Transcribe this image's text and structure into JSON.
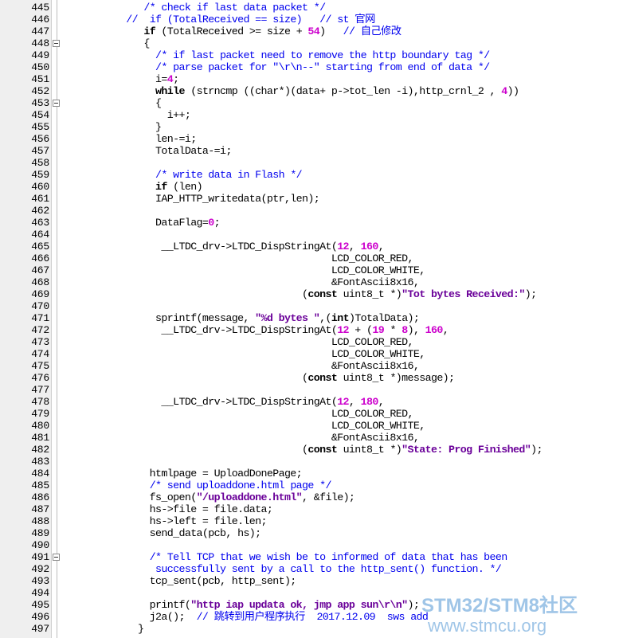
{
  "editor": {
    "lines": [
      {
        "no": "445",
        "fold": false,
        "tokens": [
          {
            "t": "            "
          },
          {
            "c": "comment",
            "t": "/* check if last data packet */"
          }
        ]
      },
      {
        "no": "446",
        "fold": false,
        "tokens": [
          {
            "t": "         "
          },
          {
            "c": "comment",
            "t": "//  if (TotalReceived == size)   // st 官网"
          }
        ]
      },
      {
        "no": "447",
        "fold": false,
        "tokens": [
          {
            "t": "            "
          },
          {
            "c": "keyword",
            "t": "if"
          },
          {
            "t": " (TotalReceived >= size + "
          },
          {
            "c": "number",
            "t": "54"
          },
          {
            "t": ")   "
          },
          {
            "c": "comment",
            "t": "// 自己修改"
          }
        ]
      },
      {
        "no": "448",
        "fold": true,
        "tokens": [
          {
            "t": "            {"
          }
        ]
      },
      {
        "no": "449",
        "fold": false,
        "tokens": [
          {
            "t": "              "
          },
          {
            "c": "comment",
            "t": "/* if last packet need to remove the http boundary tag */"
          }
        ]
      },
      {
        "no": "450",
        "fold": false,
        "tokens": [
          {
            "t": "              "
          },
          {
            "c": "comment",
            "t": "/* parse packet for \"\\r\\n--\" starting from end of data */"
          }
        ]
      },
      {
        "no": "451",
        "fold": false,
        "tokens": [
          {
            "t": "              i="
          },
          {
            "c": "number",
            "t": "4"
          },
          {
            "t": ";"
          }
        ]
      },
      {
        "no": "452",
        "fold": false,
        "tokens": [
          {
            "t": "              "
          },
          {
            "c": "keyword",
            "t": "while"
          },
          {
            "t": " (strncmp ((char*)(data+ p->tot_len -i),http_crnl_2 , "
          },
          {
            "c": "number",
            "t": "4"
          },
          {
            "t": "))"
          }
        ]
      },
      {
        "no": "453",
        "fold": true,
        "tokens": [
          {
            "t": "              {"
          }
        ]
      },
      {
        "no": "454",
        "fold": false,
        "tokens": [
          {
            "t": "                i++;"
          }
        ]
      },
      {
        "no": "455",
        "fold": false,
        "tokens": [
          {
            "t": "              }"
          }
        ]
      },
      {
        "no": "456",
        "fold": false,
        "tokens": [
          {
            "t": "              len-=i;"
          }
        ]
      },
      {
        "no": "457",
        "fold": false,
        "tokens": [
          {
            "t": "              TotalData-=i;"
          }
        ]
      },
      {
        "no": "458",
        "fold": false,
        "tokens": [
          {
            "t": ""
          }
        ]
      },
      {
        "no": "459",
        "fold": false,
        "tokens": [
          {
            "t": "              "
          },
          {
            "c": "comment",
            "t": "/* write data in Flash */"
          }
        ]
      },
      {
        "no": "460",
        "fold": false,
        "tokens": [
          {
            "t": "              "
          },
          {
            "c": "keyword",
            "t": "if"
          },
          {
            "t": " (len)"
          }
        ]
      },
      {
        "no": "461",
        "fold": false,
        "tokens": [
          {
            "t": "              IAP_HTTP_writedata(ptr,len);"
          }
        ]
      },
      {
        "no": "462",
        "fold": false,
        "tokens": [
          {
            "t": ""
          }
        ]
      },
      {
        "no": "463",
        "fold": false,
        "tokens": [
          {
            "t": "              DataFlag="
          },
          {
            "c": "number",
            "t": "0"
          },
          {
            "t": ";"
          }
        ]
      },
      {
        "no": "464",
        "fold": false,
        "tokens": [
          {
            "t": ""
          }
        ]
      },
      {
        "no": "465",
        "fold": false,
        "tokens": [
          {
            "t": "               __LTDC_drv->LTDC_DispStringAt("
          },
          {
            "c": "number",
            "t": "12"
          },
          {
            "t": ", "
          },
          {
            "c": "number",
            "t": "160"
          },
          {
            "t": ","
          }
        ]
      },
      {
        "no": "466",
        "fold": false,
        "tokens": [
          {
            "t": "                                            LCD_COLOR_RED,"
          }
        ]
      },
      {
        "no": "467",
        "fold": false,
        "tokens": [
          {
            "t": "                                            LCD_COLOR_WHITE,"
          }
        ]
      },
      {
        "no": "468",
        "fold": false,
        "tokens": [
          {
            "t": "                                            &FontAscii8x16,"
          }
        ]
      },
      {
        "no": "469",
        "fold": false,
        "tokens": [
          {
            "t": "                                       ("
          },
          {
            "c": "keyword",
            "t": "const"
          },
          {
            "t": " uint8_t *)"
          },
          {
            "c": "string",
            "t": "\"Tot bytes Received:\""
          },
          {
            "t": ");"
          }
        ]
      },
      {
        "no": "470",
        "fold": false,
        "tokens": [
          {
            "t": ""
          }
        ]
      },
      {
        "no": "471",
        "fold": false,
        "tokens": [
          {
            "t": "              sprintf(message, "
          },
          {
            "c": "string",
            "t": "\"%d bytes \""
          },
          {
            "t": ",("
          },
          {
            "c": "keyword",
            "t": "int"
          },
          {
            "t": ")TotalData);"
          }
        ]
      },
      {
        "no": "472",
        "fold": false,
        "tokens": [
          {
            "t": "               __LTDC_drv->LTDC_DispStringAt("
          },
          {
            "c": "number",
            "t": "12"
          },
          {
            "t": " + ("
          },
          {
            "c": "number",
            "t": "19"
          },
          {
            "t": " * "
          },
          {
            "c": "number",
            "t": "8"
          },
          {
            "t": "), "
          },
          {
            "c": "number",
            "t": "160"
          },
          {
            "t": ","
          }
        ]
      },
      {
        "no": "473",
        "fold": false,
        "tokens": [
          {
            "t": "                                            LCD_COLOR_RED,"
          }
        ]
      },
      {
        "no": "474",
        "fold": false,
        "tokens": [
          {
            "t": "                                            LCD_COLOR_WHITE,"
          }
        ]
      },
      {
        "no": "475",
        "fold": false,
        "tokens": [
          {
            "t": "                                            &FontAscii8x16,"
          }
        ]
      },
      {
        "no": "476",
        "fold": false,
        "tokens": [
          {
            "t": "                                       ("
          },
          {
            "c": "keyword",
            "t": "const"
          },
          {
            "t": " uint8_t *)message);"
          }
        ]
      },
      {
        "no": "477",
        "fold": false,
        "tokens": [
          {
            "t": ""
          }
        ]
      },
      {
        "no": "478",
        "fold": false,
        "tokens": [
          {
            "t": "               __LTDC_drv->LTDC_DispStringAt("
          },
          {
            "c": "number",
            "t": "12"
          },
          {
            "t": ", "
          },
          {
            "c": "number",
            "t": "180"
          },
          {
            "t": ","
          }
        ]
      },
      {
        "no": "479",
        "fold": false,
        "tokens": [
          {
            "t": "                                            LCD_COLOR_RED,"
          }
        ]
      },
      {
        "no": "480",
        "fold": false,
        "tokens": [
          {
            "t": "                                            LCD_COLOR_WHITE,"
          }
        ]
      },
      {
        "no": "481",
        "fold": false,
        "tokens": [
          {
            "t": "                                            &FontAscii8x16,"
          }
        ]
      },
      {
        "no": "482",
        "fold": false,
        "tokens": [
          {
            "t": "                                       ("
          },
          {
            "c": "keyword",
            "t": "const"
          },
          {
            "t": " uint8_t *)"
          },
          {
            "c": "string",
            "t": "\"State: Prog Finished\""
          },
          {
            "t": ");"
          }
        ]
      },
      {
        "no": "483",
        "fold": false,
        "tokens": [
          {
            "t": ""
          }
        ]
      },
      {
        "no": "484",
        "fold": false,
        "tokens": [
          {
            "t": "             htmlpage = UploadDonePage;"
          }
        ]
      },
      {
        "no": "485",
        "fold": false,
        "tokens": [
          {
            "t": "             "
          },
          {
            "c": "comment",
            "t": "/* send uploaddone.html page */"
          }
        ]
      },
      {
        "no": "486",
        "fold": false,
        "tokens": [
          {
            "t": "             fs_open("
          },
          {
            "c": "string",
            "t": "\"/uploaddone.html\""
          },
          {
            "t": ", &file);"
          }
        ]
      },
      {
        "no": "487",
        "fold": false,
        "tokens": [
          {
            "t": "             hs->file = file.data;"
          }
        ]
      },
      {
        "no": "488",
        "fold": false,
        "tokens": [
          {
            "t": "             hs->left = file.len;"
          }
        ]
      },
      {
        "no": "489",
        "fold": false,
        "tokens": [
          {
            "t": "             send_data(pcb, hs);"
          }
        ]
      },
      {
        "no": "490",
        "fold": false,
        "tokens": [
          {
            "t": ""
          }
        ]
      },
      {
        "no": "491",
        "fold": true,
        "tokens": [
          {
            "t": "             "
          },
          {
            "c": "comment",
            "t": "/* Tell TCP that we wish be to informed of data that has been"
          }
        ]
      },
      {
        "no": "492",
        "fold": false,
        "tokens": [
          {
            "t": "              "
          },
          {
            "c": "comment",
            "t": "successfully sent by a call to the http_sent() function. */"
          }
        ]
      },
      {
        "no": "493",
        "fold": false,
        "tokens": [
          {
            "t": "             tcp_sent(pcb, http_sent);"
          }
        ]
      },
      {
        "no": "494",
        "fold": false,
        "tokens": [
          {
            "t": ""
          }
        ]
      },
      {
        "no": "495",
        "fold": false,
        "tokens": [
          {
            "t": "             printf("
          },
          {
            "c": "string",
            "t": "\"http iap updata ok, jmp app sun\\r\\n\""
          },
          {
            "t": ");"
          }
        ]
      },
      {
        "no": "496",
        "fold": false,
        "tokens": [
          {
            "t": "             j2a();  "
          },
          {
            "c": "comment",
            "t": "// 跳转到用户程序执行  2017.12.09  sws add"
          }
        ]
      },
      {
        "no": "497",
        "fold": false,
        "tokens": [
          {
            "t": "           }"
          }
        ]
      }
    ]
  },
  "watermark": {
    "logo": "STM32/STM8社区",
    "url": "www.stmcu.org"
  },
  "colors": {
    "comment": "#0000ee",
    "number": "#cc00cc",
    "string": "#6a0099",
    "keyword": "#000000",
    "gutter": "#efefef"
  }
}
